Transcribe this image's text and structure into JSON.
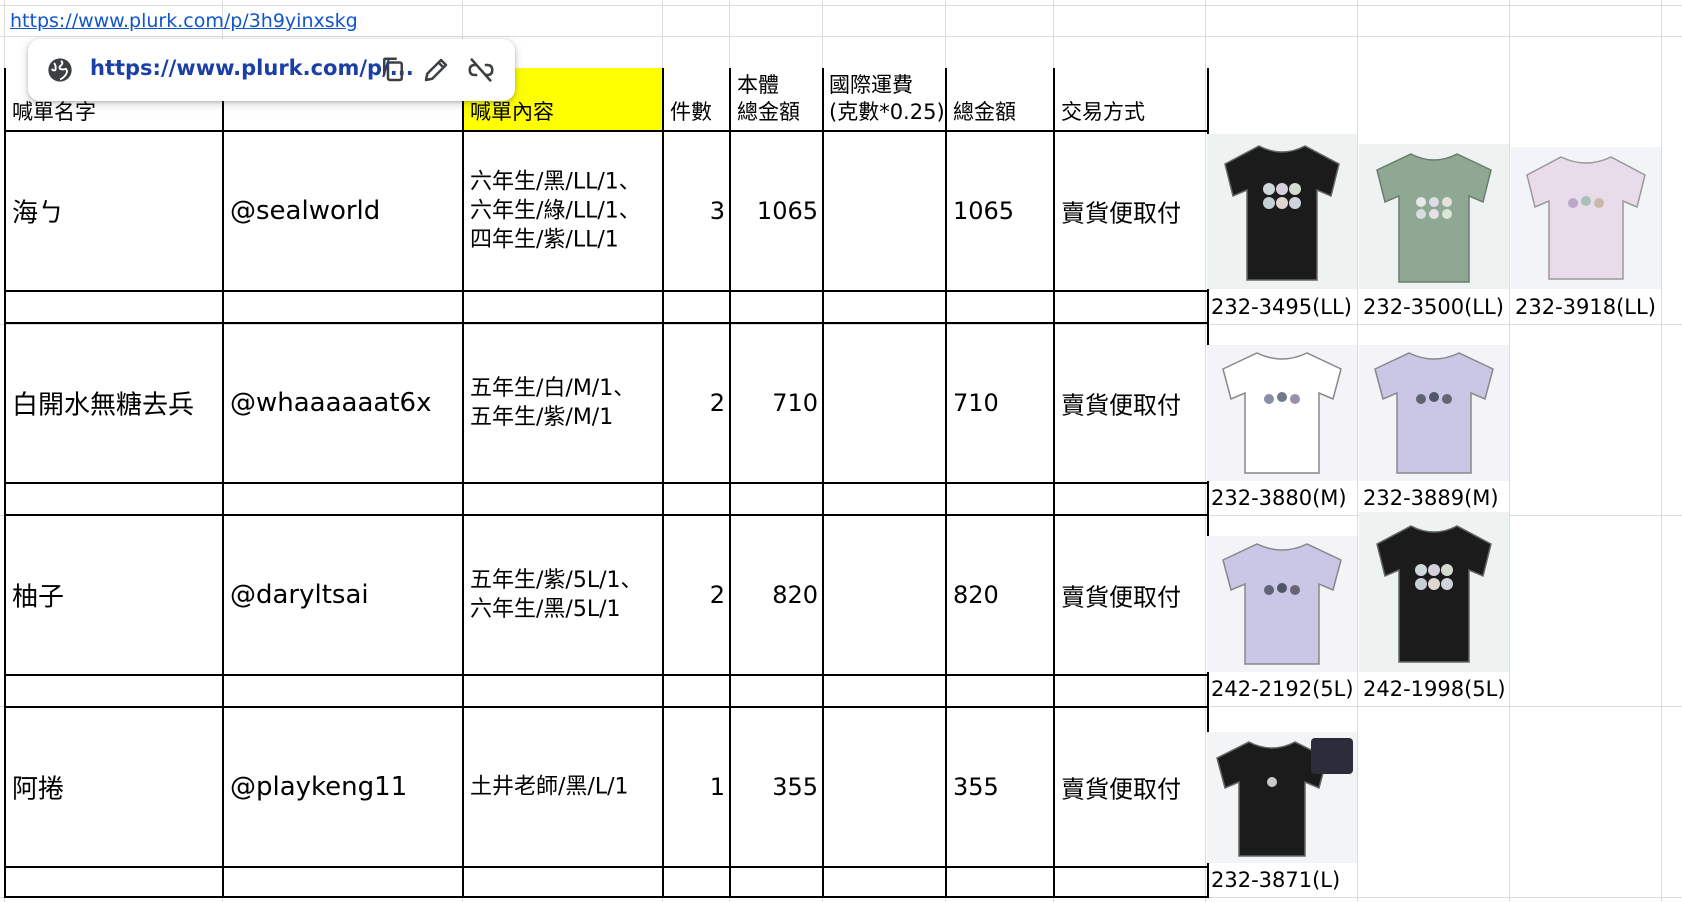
{
  "link_url": "https://www.plurk.com/p/3h9yinxskg",
  "link_chip": {
    "display_url": "https://www.plurk.com/p/...",
    "icons": [
      "globe-icon",
      "copy-icon",
      "edit-icon",
      "unlink-icon"
    ]
  },
  "headers": {
    "name": "喊單名字",
    "handle": "",
    "content": "喊單內容",
    "qty": "件數",
    "base_total_line1": "本體",
    "base_total_line2": "總金額",
    "shipping_line1": "國際運費",
    "shipping_line2": "(克數*0.25)",
    "grand_total": "總金額",
    "payment": "交易方式"
  },
  "orders": [
    {
      "name": "海ㄅ",
      "handle": "@sealworld",
      "items": [
        "六年生/黑/LL/1、",
        "六年生/綠/LL/1、",
        "四年生/紫/LL/1"
      ],
      "qty": "3",
      "base_total": "1065",
      "shipping": "",
      "total": "1065",
      "payment": "賣貨便取付",
      "products": [
        {
          "code": "232-3495(LL)",
          "shirt": "black"
        },
        {
          "code": "232-3500(LL)",
          "shirt": "green"
        },
        {
          "code": "232-3918(LL)",
          "shirt": "pink"
        }
      ]
    },
    {
      "name": "白開水無糖去兵",
      "handle": "@whaaaaaat6x",
      "items": [
        "五年生/白/M/1、",
        "五年生/紫/M/1"
      ],
      "qty": "2",
      "base_total": "710",
      "shipping": "",
      "total": "710",
      "payment": "賣貨便取付",
      "products": [
        {
          "code": "232-3880(M)",
          "shirt": "white"
        },
        {
          "code": "232-3889(M)",
          "shirt": "lavender"
        }
      ]
    },
    {
      "name": "柚子",
      "handle": "@daryltsai",
      "items": [
        "五年生/紫/5L/1、",
        "六年生/黑/5L/1"
      ],
      "qty": "2",
      "base_total": "820",
      "shipping": "",
      "total": "820",
      "payment": "賣貨便取付",
      "products": [
        {
          "code": "242-2192(5L)",
          "shirt": "lavender"
        },
        {
          "code": "242-1998(5L)",
          "shirt": "black"
        }
      ]
    },
    {
      "name": "阿捲",
      "handle": "@playkeng11",
      "items": [
        "土井老師/黑/L/1"
      ],
      "qty": "1",
      "base_total": "355",
      "shipping": "",
      "total": "355",
      "payment": "賣貨便取付",
      "products": [
        {
          "code": "232-3871(L)",
          "shirt": "black"
        }
      ]
    }
  ],
  "colors": {
    "header_highlight": "#ffff00",
    "link": "#1155cc",
    "shirt_black": "#1b1b1b",
    "shirt_green": "#8ea893",
    "shirt_pink": "#e8dcea",
    "shirt_white": "#ffffff",
    "shirt_lavender": "#c9c6e6"
  }
}
